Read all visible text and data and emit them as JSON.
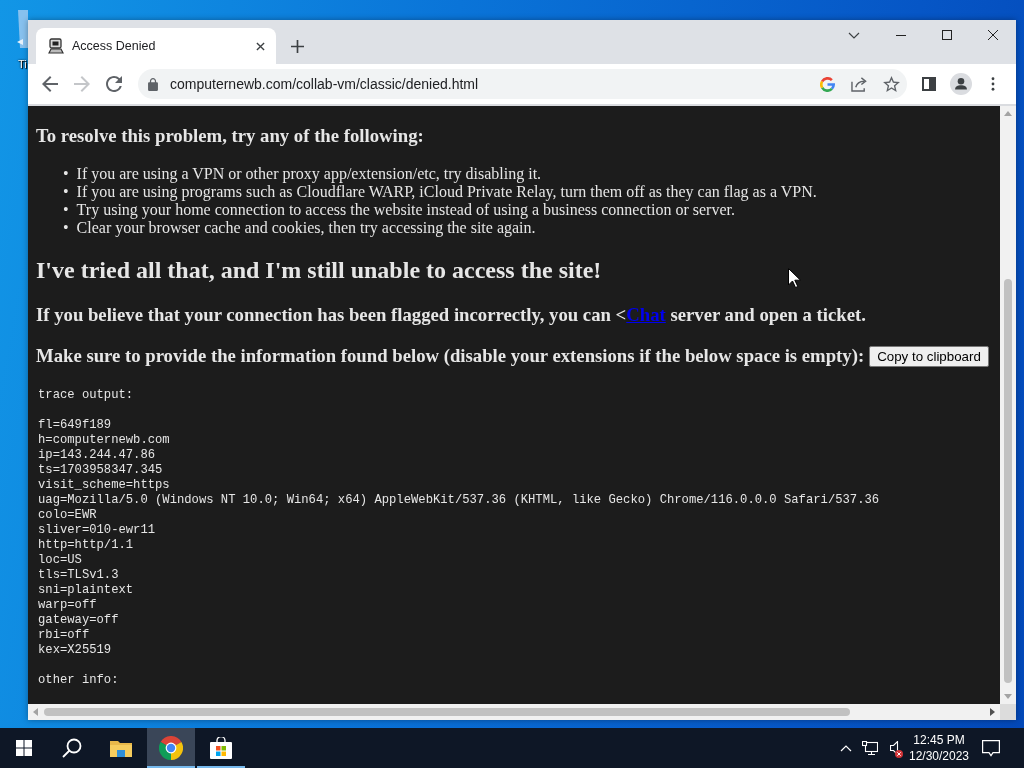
{
  "desktop": {
    "icon_label": "Ti"
  },
  "browser": {
    "tabs": [
      {
        "title": "Access Denied",
        "selected": true
      }
    ],
    "forward_disabled": true,
    "url": "computernewb.com/collab-vm/classic/denied.html"
  },
  "page": {
    "heading": "To resolve this problem, try any of the following:",
    "steps": [
      {
        "marker": "•",
        "text": "If you are using a VPN or other proxy app/extension/etc, try disabling it."
      },
      {
        "marker": "•",
        "text": "If you are using programs such as Cloudflare WARP, iCloud Private Relay, turn them off as they can flag as a VPN."
      },
      {
        "marker": "•",
        "text": "Try using your home connection to access the website instead of using a business connection or server."
      },
      {
        "marker": "•",
        "text": "Clear your browser cache and cookies, then try accessing the site again."
      }
    ],
    "title": "I've tried all that, and I'm still unable to access the site!",
    "contact": {
      "text_before": "If you believe that your connection has been flagged incorrectly, you can <",
      "link": "Chat",
      "text_after": "server and open a ticket."
    },
    "instructions": "Make sure to provide the information found below (disable your extensions if the below space is empty):",
    "copy_button": "Copy to clipboard",
    "trace_header": "trace output:",
    "trace_fields": [
      "fl=649f189",
      "h=computernewb.com",
      "ip=143.244.47.86",
      "ts=1703958347.345",
      "visit_scheme=https",
      "uag=Mozilla/5.0 (Windows NT 10.0; Win64; x64) AppleWebKit/537.36 (KHTML, like Gecko) Chrome/116.0.0.0 Safari/537.36",
      "colo=EWR",
      "sliver=010-ewr11",
      "http=http/1.1",
      "loc=US",
      "tls=TLSv1.3",
      "sni=plaintext",
      "warp=off",
      "gateway=off",
      "rbi=off",
      "kex=X25519"
    ],
    "trace_footer": "other info:"
  },
  "taskbar": {
    "apps": [
      {
        "kind": "explorer",
        "selected": false,
        "running": false
      },
      {
        "kind": "chrome",
        "selected": true,
        "running": true
      },
      {
        "kind": "store",
        "selected": false,
        "running": true
      }
    ],
    "sound_muted": true,
    "time": "12:45 PM",
    "date": "12/30/2023"
  }
}
